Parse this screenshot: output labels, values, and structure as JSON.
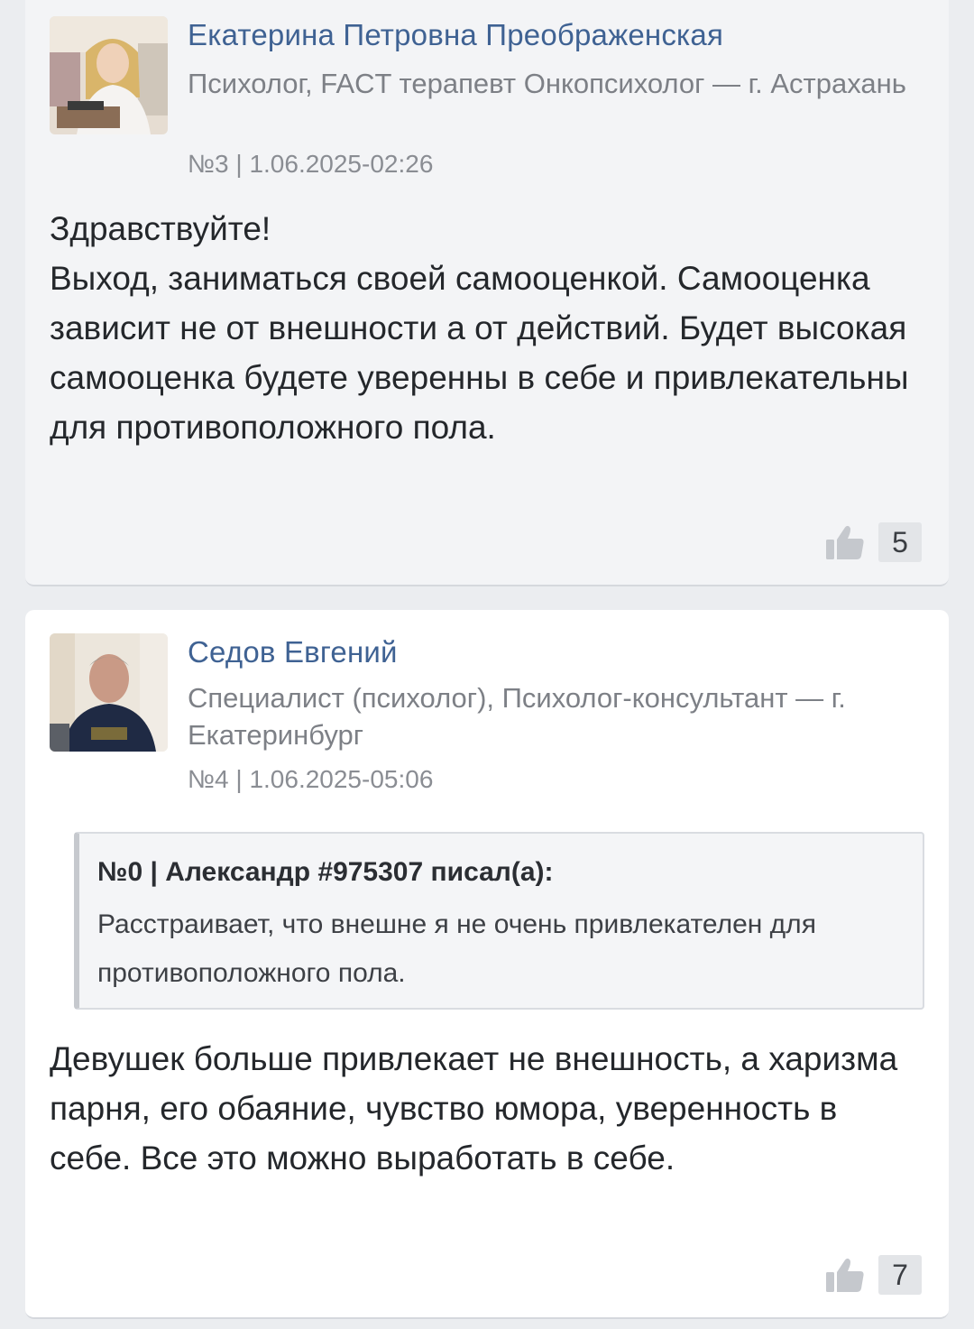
{
  "comments": [
    {
      "author": "Екатерина Петровна Преображенская",
      "role": "Психолог, FACT терапевт Онкопсихолог — г. Астрахань",
      "meta": "№3 | 1.06.2025-02:26",
      "body": "Здравствуйте!\nВыход, заниматься своей самооценкой. Самооценка зависит не от внешности а от действий. Будет высокая самооценка будете уверенны в себе и привлекательны для противоположного пола.",
      "likes": "5",
      "like_icon": "thumbs-up-icon"
    },
    {
      "author": "Седов Евгений",
      "role": "Специалист (психолог), Психолог-консультант — г. Екатеринбург",
      "meta": "№4 | 1.06.2025-05:06",
      "quote": {
        "header": "№0 | Александр #975307 писал(а):",
        "text": "Расстраивает, что внешне я не очень привлекателен для противоположного пола."
      },
      "body": "Девушек больше привлекает не внешность, а харизма парня, его обаяние, чувство юмора, уверенность в себе. Все это можно выработать в себе.",
      "likes": "7",
      "like_icon": "thumbs-up-icon"
    }
  ],
  "colors": {
    "author_link": "#3f6293",
    "page_background": "#ebedf0",
    "card_background": "#ffffff",
    "card_background_muted": "#f3f4f6"
  }
}
